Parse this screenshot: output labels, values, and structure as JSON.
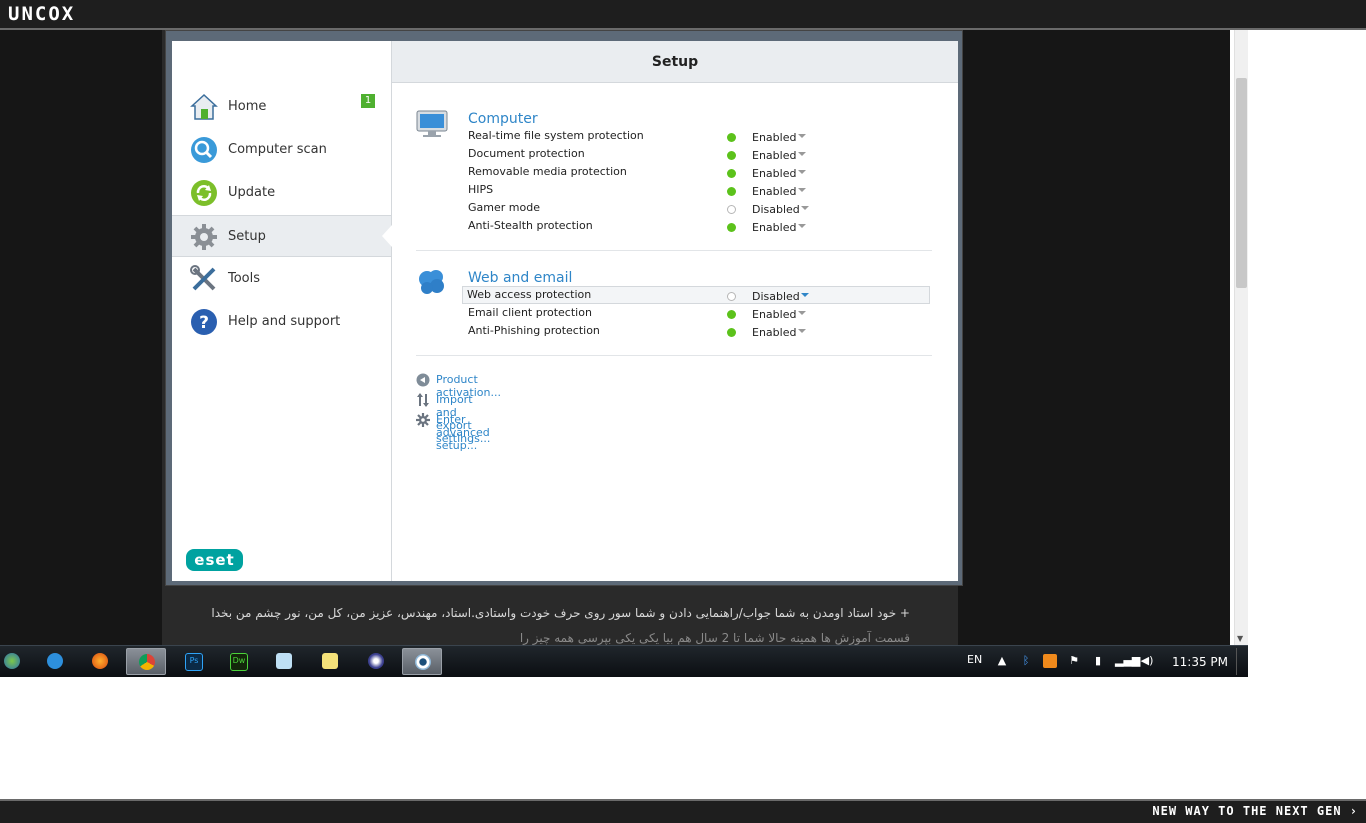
{
  "site": {
    "logo": "UNCOX",
    "tagline": "NEW WAY TO THE NEXT GEN ›",
    "page_text_line1": "+ خود استاد اومدن به شما جواب/راهنمایی دادن و شما سور روی حرف خودت واستادی.استاد، مهندس، عزیز من، کل من، نور چشم من بخدا",
    "page_text_line2": "قسمت آموزش ها همینه حالا شما تا 2 سال هم بیا یکی یکی بپرسی همه چیز را"
  },
  "eset": {
    "logo": "eset",
    "header_title": "Setup",
    "nav": [
      {
        "label": "Home",
        "badge": "1",
        "icon": "home-icon"
      },
      {
        "label": "Computer scan",
        "icon": "magnifier-icon"
      },
      {
        "label": "Update",
        "icon": "refresh-icon"
      },
      {
        "label": "Setup",
        "icon": "gear-icon",
        "active": true
      },
      {
        "label": "Tools",
        "icon": "tools-icon"
      },
      {
        "label": "Help and support",
        "icon": "question-icon"
      }
    ],
    "sections": [
      {
        "title": "Computer",
        "icon": "monitor-icon",
        "rows": [
          {
            "label": "Real-time file system protection",
            "state": "Enabled",
            "enabled": true
          },
          {
            "label": "Document protection",
            "state": "Enabled",
            "enabled": true
          },
          {
            "label": "Removable media protection",
            "state": "Enabled",
            "enabled": true
          },
          {
            "label": "HIPS",
            "state": "Enabled",
            "enabled": true
          },
          {
            "label": "Gamer mode",
            "state": "Disabled",
            "enabled": false
          },
          {
            "label": "Anti-Stealth protection",
            "state": "Enabled",
            "enabled": true
          }
        ]
      },
      {
        "title": "Web and email",
        "icon": "cloud-icon",
        "rows": [
          {
            "label": "Web access protection",
            "state": "Disabled",
            "enabled": false,
            "highlighted": true
          },
          {
            "label": "Email client protection",
            "state": "Enabled",
            "enabled": true
          },
          {
            "label": "Anti-Phishing protection",
            "state": "Enabled",
            "enabled": true
          }
        ]
      }
    ],
    "links": [
      {
        "label": "Product activation...",
        "icon": "arrow-left-circle-icon"
      },
      {
        "label": "Import and export settings...",
        "icon": "import-export-icon"
      },
      {
        "label": "Enter advanced setup...",
        "icon": "gear-icon"
      }
    ]
  },
  "taskbar": {
    "apps": [
      "start-orb-icon",
      "internet-explorer-icon",
      "firefox-icon",
      "chrome-icon",
      "photoshop-icon",
      "dreamweaver-icon",
      "notepad-icon",
      "sticky-notes-icon",
      "eclipse-icon",
      "eset-icon"
    ],
    "language": "EN",
    "clock": "11:35 PM"
  },
  "colors": {
    "accent_blue": "#2f86c8",
    "enabled_green": "#5cc21b",
    "eset_teal": "#00a2a0"
  }
}
